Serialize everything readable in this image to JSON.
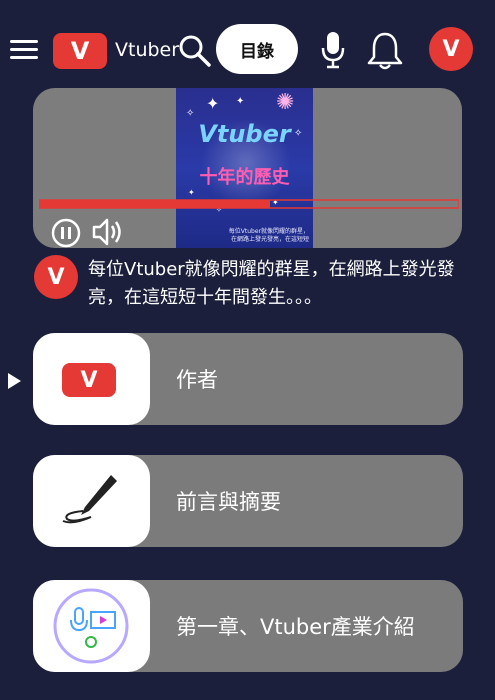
{
  "header": {
    "logo_letter": "V",
    "brand": "Vtuber",
    "menu_label": "目錄",
    "avatar_letter": "V"
  },
  "video": {
    "thumb_title": "Vtuber",
    "thumb_subtitle": "十年的歷史",
    "thumb_caption_1": "每位Vtuber就像閃耀的群星，",
    "thumb_caption_2": "在網路上發光發亮，在這短短",
    "progress": 0.55
  },
  "description": {
    "avatar_letter": "V",
    "text": "每位Vtuber就像閃耀的群星，在網路上發光發亮，在這短短十年間發生。。。"
  },
  "chapters": [
    {
      "label": "作者",
      "icon": "vtuber-logo-icon",
      "letter": "V"
    },
    {
      "label": "前言與摘要",
      "icon": "pen-icon"
    },
    {
      "label": "第一章、Vtuber產業介紹",
      "icon": "streaming-setup-icon"
    }
  ],
  "colors": {
    "background": "#1b1f3b",
    "accent": "#e53935",
    "card": "#7b7b7b",
    "progress": "#e53935"
  }
}
